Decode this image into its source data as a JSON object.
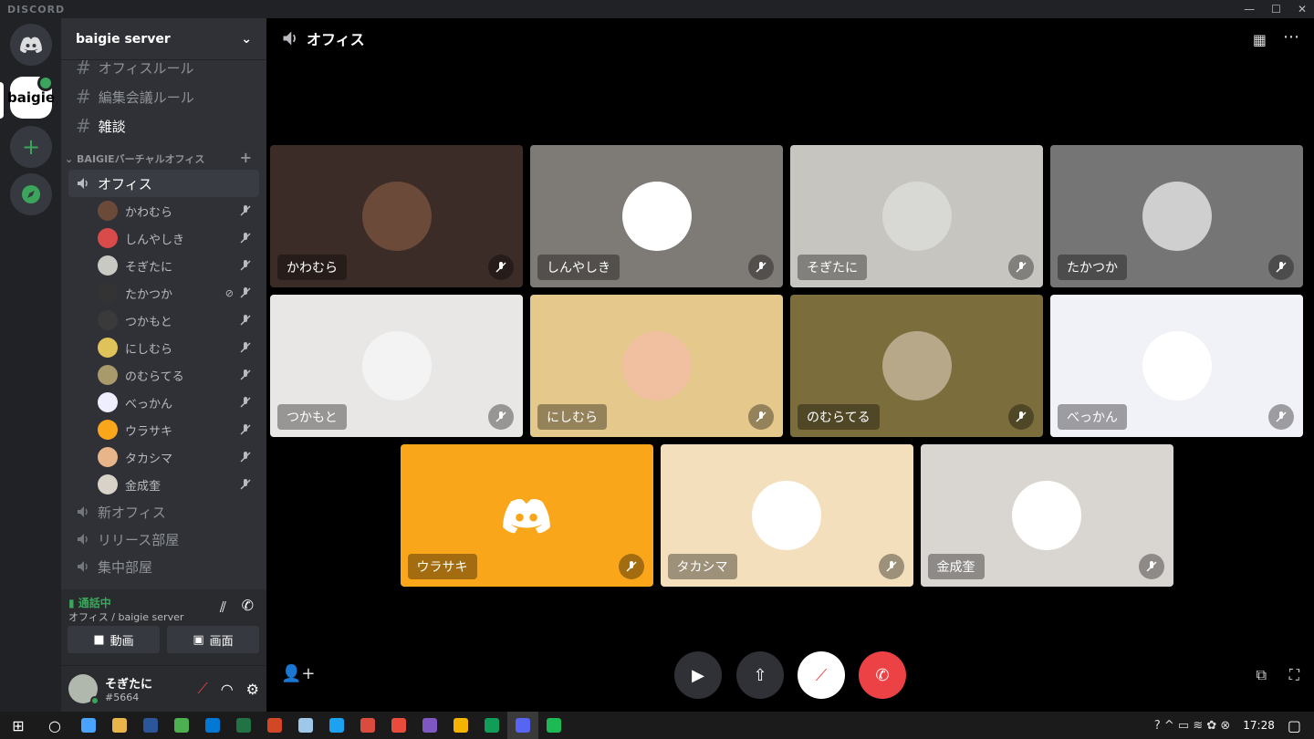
{
  "app": {
    "brand": "DISCORD"
  },
  "guilds": {
    "baigie_label": "baigie",
    "add": "+"
  },
  "server": {
    "name": "baigie server"
  },
  "text_channels": [
    {
      "name": "オフィスルール"
    },
    {
      "name": "編集会議ルール"
    },
    {
      "name": "雑談"
    }
  ],
  "category": {
    "name": "BAIGIEバーチャルオフィス",
    "add": "+"
  },
  "voice_channels": {
    "active": "オフィス",
    "others": [
      "新オフィス",
      "リリース部屋",
      "集中部屋"
    ]
  },
  "voice_users": [
    {
      "name": "かわむら",
      "color": "#6b4a3a"
    },
    {
      "name": "しんやしき",
      "color": "#d94a4a"
    },
    {
      "name": "そぎたに",
      "color": "#c9c9c4"
    },
    {
      "name": "たかつか",
      "color": "#333333"
    },
    {
      "name": "つかもと",
      "color": "#3a3a3a"
    },
    {
      "name": "にしむら",
      "color": "#e0c25a"
    },
    {
      "name": "のむらてる",
      "color": "#a89a6a"
    },
    {
      "name": "べっかん",
      "color": "#eeeeff"
    },
    {
      "name": "ウラサキ",
      "color": "#faa61a"
    },
    {
      "name": "タカシマ",
      "color": "#e8b48a"
    },
    {
      "name": "金成奎",
      "color": "#d8d2c8"
    }
  ],
  "voice_panel": {
    "status": "通話中",
    "location": "オフィス / baigie server",
    "video": "動画",
    "screen": "画面"
  },
  "user": {
    "name": "そぎたに",
    "tag": "#5664"
  },
  "stage": {
    "title": "オフィス",
    "tiles": [
      {
        "name": "かわむら",
        "bg": "#3b2c27",
        "avatar": "#6b4a3a"
      },
      {
        "name": "しんやしき",
        "bg": "#7e7a75",
        "avatar": "#ffffff"
      },
      {
        "name": "そぎたに",
        "bg": "#c6c5c0",
        "avatar": "#d8d8d4"
      },
      {
        "name": "たかつか",
        "bg": "#757575",
        "avatar": "#cfcfcf"
      },
      {
        "name": "つかもと",
        "bg": "#e9e7e5",
        "avatar": "#f3f3f3"
      },
      {
        "name": "にしむら",
        "bg": "#e4c88c",
        "avatar": "#f0c0a0"
      },
      {
        "name": "のむらてる",
        "bg": "#7c6e3c",
        "avatar": "#b7a88a"
      },
      {
        "name": "べっかん",
        "bg": "#f1f2f8",
        "avatar": "#ffffff"
      },
      {
        "name": "ウラサキ",
        "bg": "#faa61a",
        "avatar": "#faa61a"
      },
      {
        "name": "タカシマ",
        "bg": "#f3dfbb",
        "avatar": "#ffffff"
      },
      {
        "name": "金成奎",
        "bg": "#d9d5d0",
        "avatar": "#ffffff"
      }
    ]
  },
  "taskbar": {
    "time": "17:28",
    "apps": [
      "#4aa3ff",
      "#e8b64a",
      "#2b579a",
      "#4caf50",
      "#0078d4",
      "#217346",
      "#d24726",
      "#9ec7e8",
      "#1da1f2",
      "#db4c3f",
      "#e94b3c",
      "#7e57c2",
      "#f4b400",
      "#0f9d58",
      "#5865f2",
      "#1db954"
    ]
  }
}
